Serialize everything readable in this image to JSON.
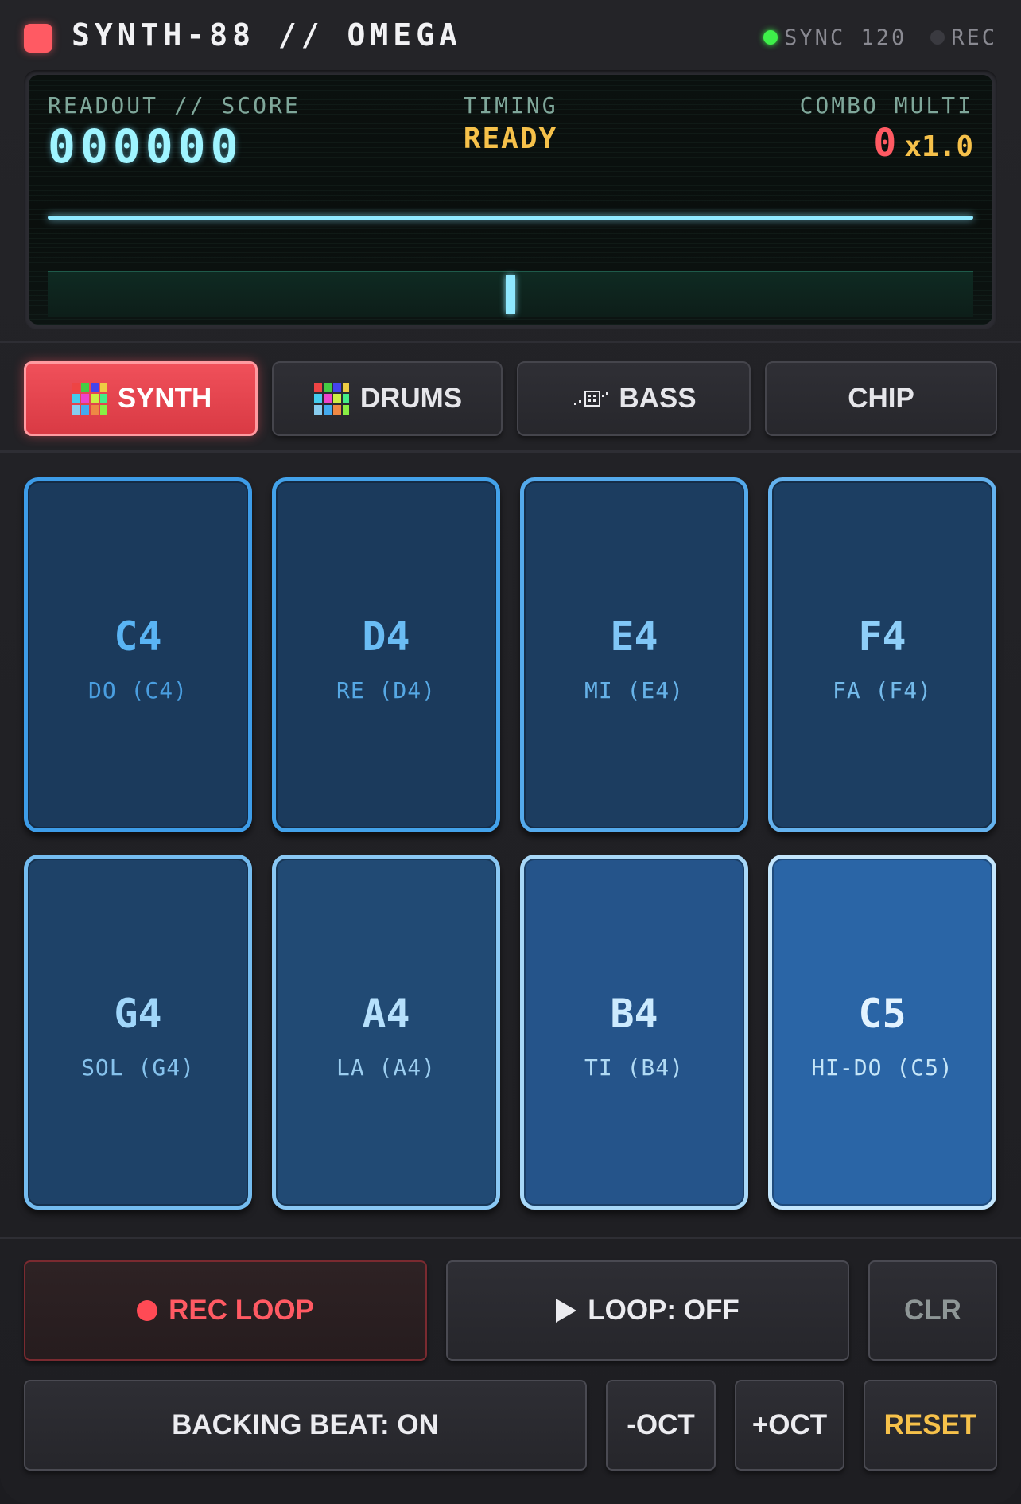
{
  "header": {
    "brand": "SYNTH-88 // OMEGA",
    "sync_label": "SYNC 120",
    "rec_label": "REC",
    "power_icon": "power-led-icon"
  },
  "display": {
    "score_label": "READOUT // SCORE",
    "score_value": "000000",
    "timing_label": "TIMING",
    "timing_value": "READY",
    "combo_label": "COMBO MULTI",
    "combo_value": "0",
    "multiplier_value": "x1.0",
    "timing_marker_position": 0.5
  },
  "instruments": [
    {
      "label": "SYNTH",
      "icon": "keyboard-icon",
      "active": true
    },
    {
      "label": "DRUMS",
      "icon": "keyboard-icon",
      "active": false
    },
    {
      "label": "BASS",
      "icon": "bass-icon",
      "active": false
    },
    {
      "label": "CHIP",
      "icon": "",
      "active": false
    }
  ],
  "pads": [
    {
      "note": "C4",
      "solfege": "DO (C4)"
    },
    {
      "note": "D4",
      "solfege": "RE (D4)"
    },
    {
      "note": "E4",
      "solfege": "MI (E4)"
    },
    {
      "note": "F4",
      "solfege": "FA (F4)"
    },
    {
      "note": "G4",
      "solfege": "SOL (G4)"
    },
    {
      "note": "A4",
      "solfege": "LA (A4)"
    },
    {
      "note": "B4",
      "solfege": "TI (B4)"
    },
    {
      "note": "C5",
      "solfege": "HI-DO (C5)"
    }
  ],
  "transport": {
    "rec_loop_label": "REC LOOP",
    "loop_label": "LOOP: OFF",
    "clear_label": "CLR",
    "backing_beat_label": "BACKING BEAT: ON",
    "octave_down_label": "-OCT",
    "octave_up_label": "+OCT",
    "reset_label": "RESET"
  },
  "colors": {
    "accent_red": "#ff5a63",
    "screen_cyan": "#9ff4ff",
    "screen_amber": "#f6c14a",
    "status_green": "#3ef04a"
  }
}
